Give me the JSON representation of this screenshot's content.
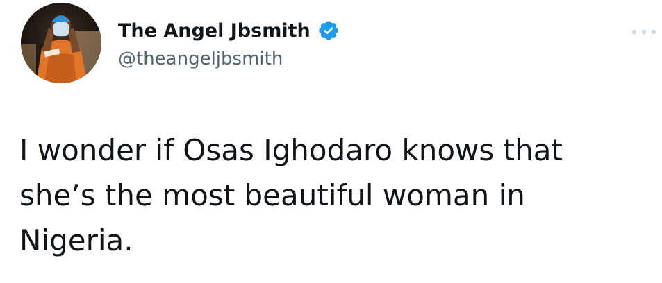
{
  "tweet": {
    "author": {
      "display_name": "The Angel Jbsmith",
      "handle": "@theangeljbsmith",
      "verified": true,
      "avatar_icon": "profile-photo"
    },
    "text": "I wonder if Osas Ighodaro knows that\nshe’s the most beautiful woman in\nNigeria.",
    "more_icon": "more-options-icon"
  },
  "colors": {
    "text_primary": "#0f1419",
    "text_secondary": "#536471",
    "verified_badge": "#1d9bf0",
    "more_dots": "#cfd9de"
  }
}
